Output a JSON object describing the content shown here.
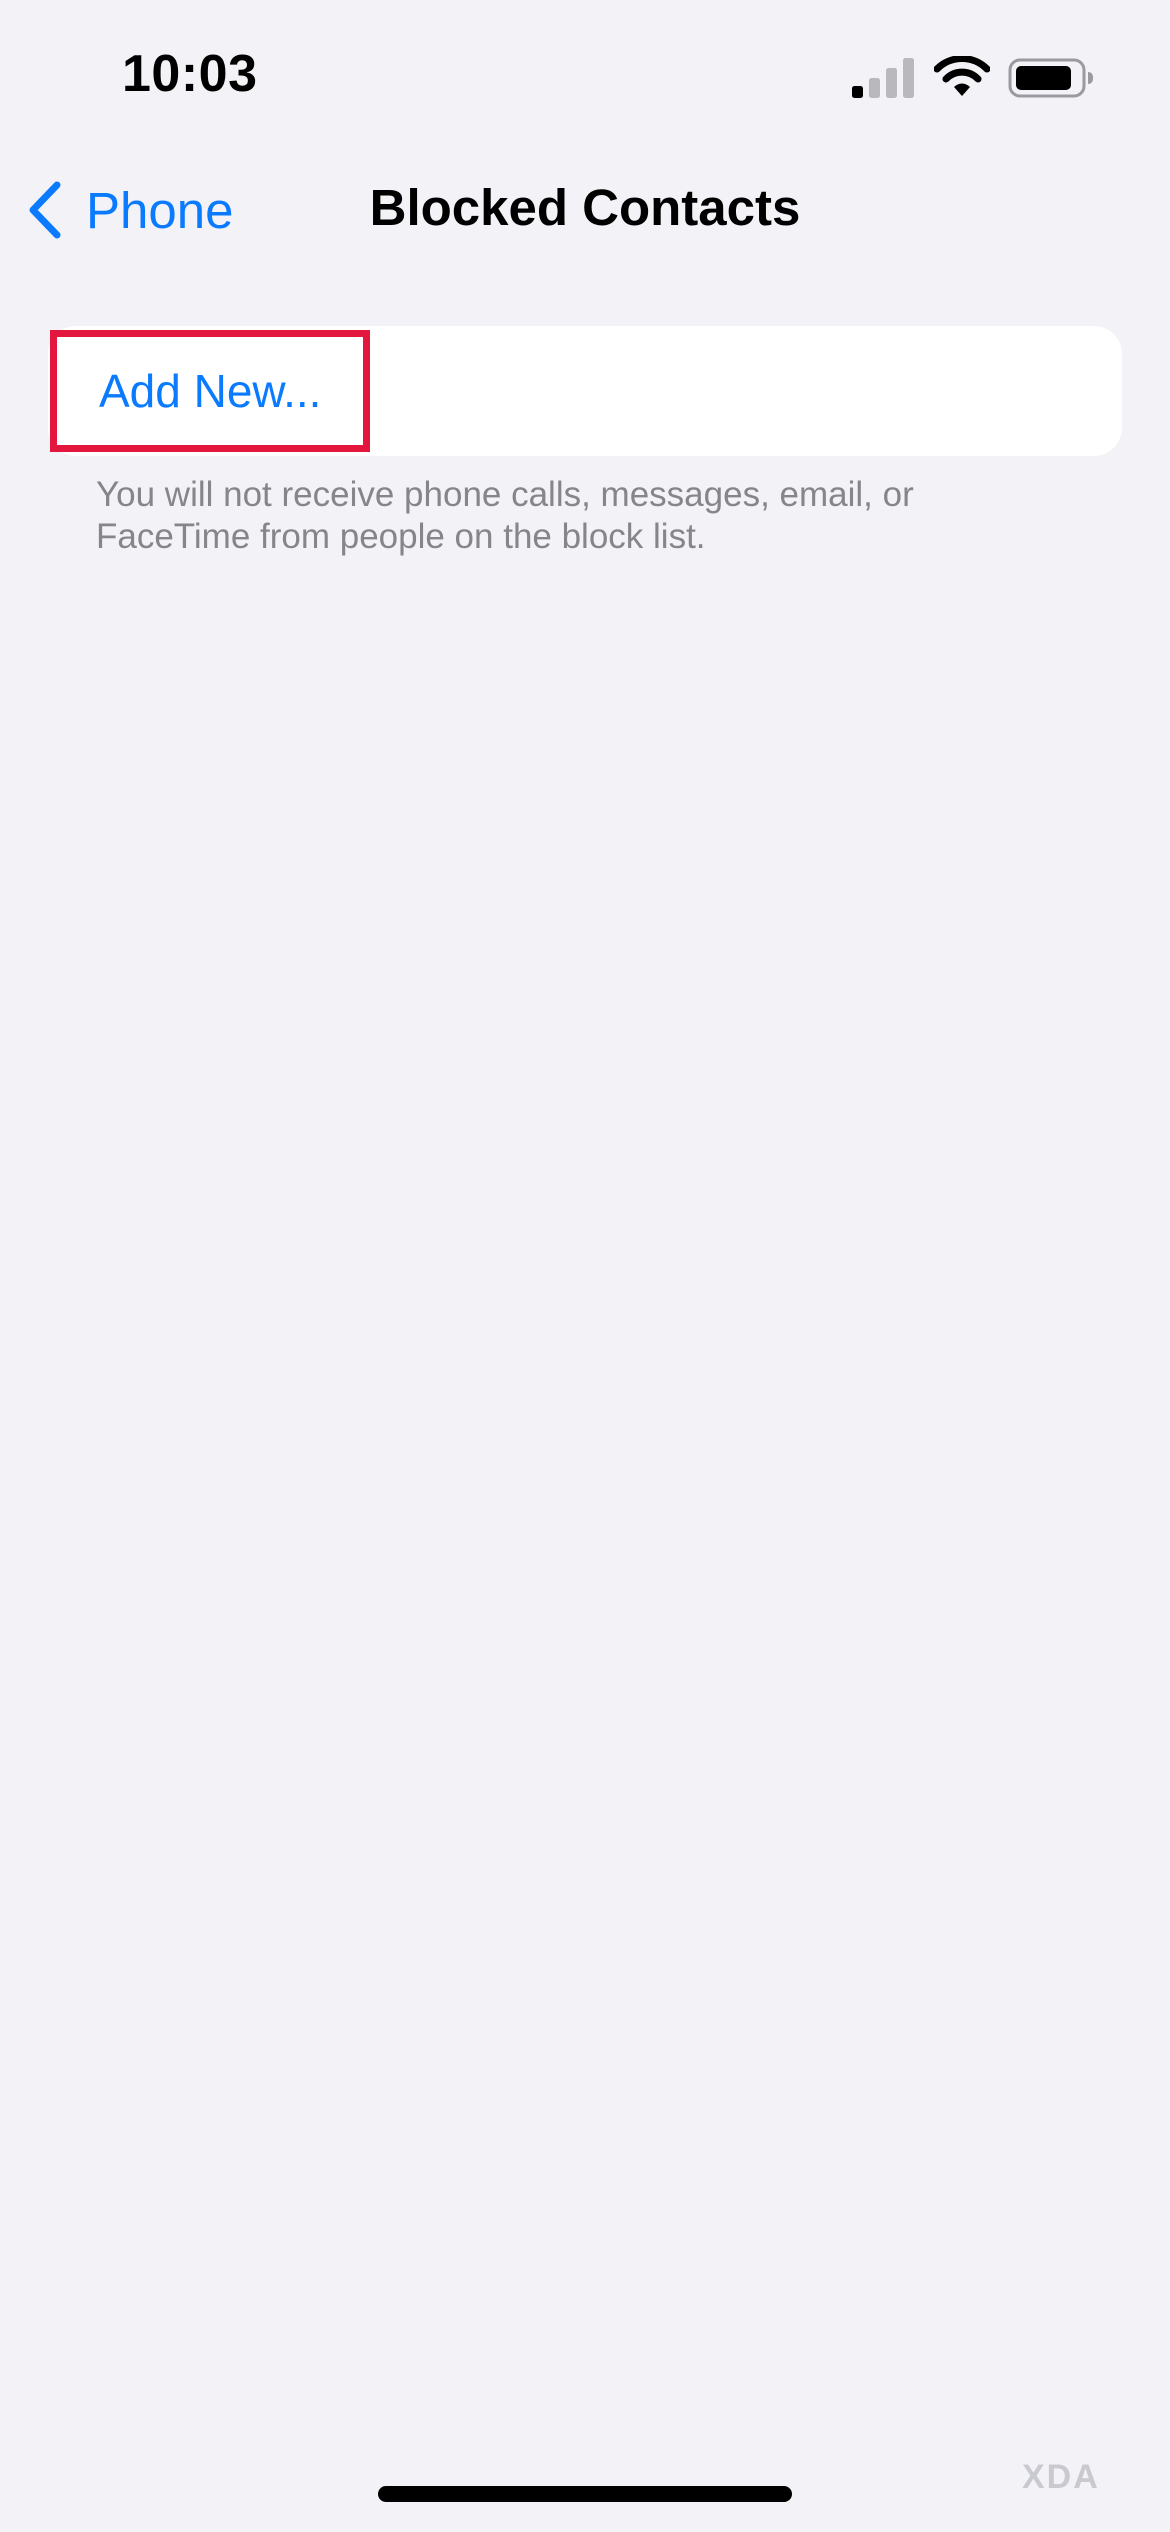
{
  "status_bar": {
    "time": "10:03",
    "signal_bars_filled": 1,
    "signal_bars_total": 4,
    "wifi_icon": "wifi-icon",
    "battery_level": 0.85
  },
  "nav": {
    "back_label": "Phone",
    "back_icon": "chevron-left-icon",
    "title": "Blocked Contacts"
  },
  "list": {
    "add_new_label": "Add New...",
    "footer_note": "You will not receive phone calls, messages, email, or FaceTime from people on the block list."
  },
  "watermark": {
    "text": "XDA"
  },
  "colors": {
    "accent": "#0a7aff",
    "highlight_box": "#e3173d",
    "background": "#f2f2f7",
    "secondary_text": "#85858a"
  }
}
